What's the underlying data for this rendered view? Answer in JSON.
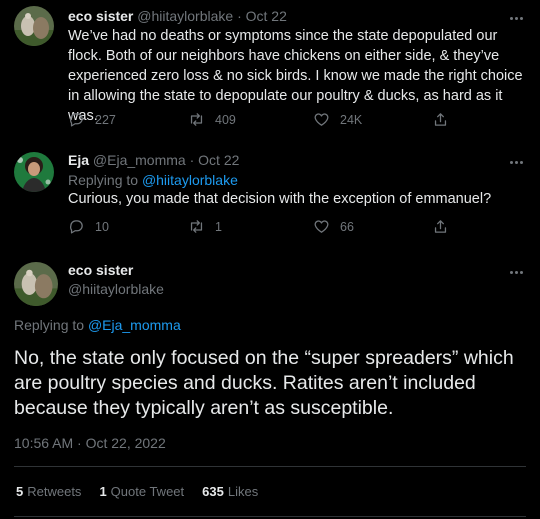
{
  "tweets": [
    {
      "name": "eco sister",
      "handle": "@hiitaylorblake",
      "sep": "·",
      "date": "Oct 22",
      "text": "We’ve had no deaths or symptoms since the state depopulated our flock. Both of our neighbors have chickens on either side, & they’ve experienced zero loss & no sick birds. I know we made the right choice in allowing the state to depopulate our poultry & ducks, as hard as it was.",
      "replies": "227",
      "retweets": "409",
      "likes": "24K"
    },
    {
      "name": "Eja",
      "handle": "@Eja_momma",
      "sep": "·",
      "date": "Oct 22",
      "replying_prefix": "Replying to",
      "replying_to": "@hiitaylorblake",
      "text": "Curious, you made that decision with the exception of emmanuel?",
      "replies": "10",
      "retweets": "1",
      "likes": "66"
    }
  ],
  "main": {
    "name": "eco sister",
    "handle": "@hiitaylorblake",
    "replying_prefix": "Replying to",
    "replying_to": "@Eja_momma",
    "text": "No, the state only focused on the “super spreaders” which are poultry species and ducks. Ratites aren’t included because they typically aren’t as susceptible.",
    "timestamp": "10:56 AM · Oct 22, 2022",
    "stats": {
      "retweets_count": "5",
      "retweets_label": "Retweets",
      "quotes_count": "1",
      "quotes_label": "Quote Tweet",
      "likes_count": "635",
      "likes_label": "Likes"
    }
  },
  "colors": {
    "background": "#000000",
    "text": "#e7e9ea",
    "muted": "#71767b",
    "accent": "#1d9bf0"
  }
}
